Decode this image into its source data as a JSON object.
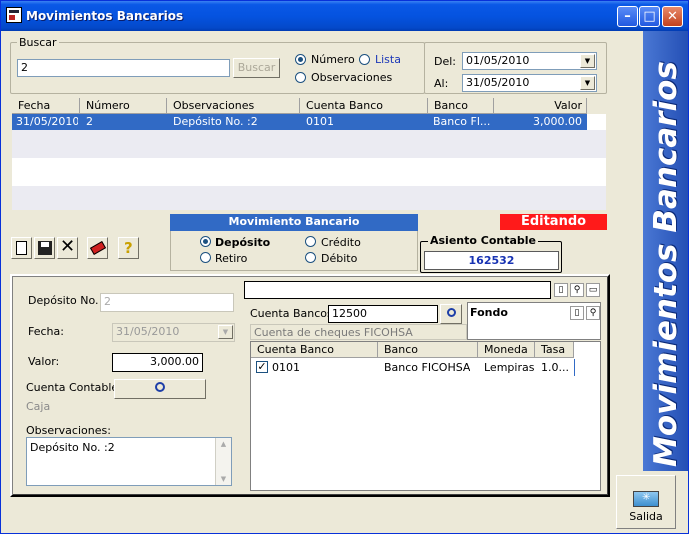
{
  "window": {
    "title": "Movimientos Bancarios"
  },
  "sidebar": {
    "text": "Movimientos Bancarios"
  },
  "search": {
    "group_label": "Buscar",
    "input_value": "2",
    "button_label": "Buscar",
    "radio_numero": "Número",
    "radio_lista": "Lista",
    "radio_observaciones": "Observaciones",
    "del_label": "Del:",
    "del_value": "01/05/2010",
    "al_label": "Al:",
    "al_value": "31/05/2010"
  },
  "grid": {
    "headers": [
      "Fecha",
      "Número",
      "Observaciones",
      "Cuenta Banco",
      "Banco",
      "Valor"
    ],
    "rows": [
      {
        "fecha": "31/05/2010",
        "numero": "2",
        "observaciones": "Depósito No. :2",
        "cuenta": "0101",
        "banco": "Banco Fl...",
        "valor": "3,000.00"
      }
    ]
  },
  "movimiento": {
    "header": "Movimiento Bancario",
    "deposito": "Depósito",
    "credito": "Crédito",
    "retiro": "Retiro",
    "debito": "Débito"
  },
  "status": {
    "label": "Editando",
    "color": "#ff1a1a"
  },
  "asiento": {
    "label": "Asiento Contable",
    "value": "162532"
  },
  "form": {
    "deposito_label": "Depósito No. :",
    "deposito_value": "2",
    "fecha_label": "Fecha:",
    "fecha_value": "31/05/2010",
    "valor_label": "Valor:",
    "valor_value": "3,000.00",
    "cuenta_label": "Cuenta Contable:",
    "cuenta_value": "Caja",
    "obs_label": "Observaciones:",
    "obs_value": "Depósito No. :2"
  },
  "bank": {
    "cuenta_label": "Cuenta Bancos:",
    "cuenta_value": "12500",
    "cuenta_desc": "Cuenta de cheques FICOHSA",
    "fondo_label": "Fondo",
    "headers": [
      "Cuenta Banco",
      "Banco",
      "Moneda",
      "Tasa"
    ],
    "rows": [
      {
        "cuenta": "0101",
        "banco": "Banco FICOHSA",
        "moneda": "Lempiras",
        "tasa": "1.0..."
      }
    ]
  },
  "footer": {
    "salida_label": "Salida"
  }
}
